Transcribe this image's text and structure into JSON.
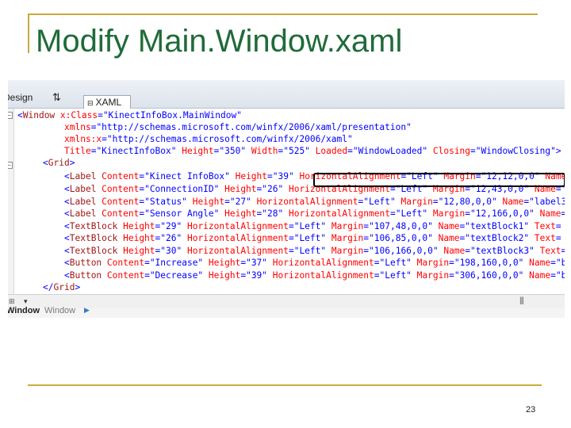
{
  "slide": {
    "title": "Modify Main.Window.xaml",
    "page_number": "23"
  },
  "designer": {
    "tabs": {
      "design": "Design",
      "swap_glyph": "⇅",
      "xaml": "XAML",
      "xaml_glyph": "⊟"
    },
    "breadcrumb": {
      "first": "Window",
      "second": "Window",
      "arrow": "▶"
    },
    "scrollbar": {
      "zoom_glyph": "⊞",
      "dropdown_glyph": "▾",
      "grip_glyph": "|||"
    }
  },
  "colors": {
    "title": "#1f6b39",
    "decor_rule": "#c8ac3a",
    "xml_element": "#a31515",
    "xml_attribute": "#ff0000",
    "xml_value": "#0000ff",
    "callout_border": "#000000"
  },
  "code": {
    "l1_lt": "<",
    "l1_tag": "Window",
    "l1_a1": " x:Class",
    "l1_e": "=",
    "l1_v1": "\"KinectInfoBox.MainWindow\"",
    "l2_a1": "xmlns",
    "l2_e": "=",
    "l2_v1": "\"http://schemas.microsoft.com/winfx/2006/xaml/presentation\"",
    "l3_a1": "xmlns:x",
    "l3_e": "=",
    "l3_v1": "\"http://schemas.microsoft.com/winfx/2006/xaml\"",
    "l4_a1": "Title",
    "l4_e1": "=",
    "l4_v1": "\"KinectInfoBox\"",
    "l4_a2": " Height",
    "l4_e2": "=",
    "l4_v2": "\"350\"",
    "l4_a3": " Width",
    "l4_e3": "=",
    "l4_v3": "\"525\"",
    "l4_a4": " Loaded",
    "l4_e4": "=",
    "l4_v4": "\"WindowLoaded\"",
    "l4_a5": " Closing",
    "l4_e5": "=",
    "l4_v5": "\"WindowClosing\"",
    "l4_gt": ">",
    "l5_lt": "<",
    "l5_tag": "Grid",
    "l5_gt": ">",
    "l6_lt": "<",
    "l6_tag": "Label",
    "l6_a1": " Content",
    "l6_e1": "=",
    "l6_v1": "\"Kinect InfoBox\"",
    "l6_a2": " Height",
    "l6_e2": "=",
    "l6_v2": "\"39\"",
    "l6_a3": " HorizontalAlignment",
    "l6_e3": "=",
    "l6_v3": "\"Left\"",
    "l6_a4": " Margin",
    "l6_e4": "=",
    "l6_v4": "\"12,12,0,0\"",
    "l6_a5": " Name",
    "l6_e5": "=",
    "l7_lt": "<",
    "l7_tag": "Label",
    "l7_a1": " Content",
    "l7_e1": "=",
    "l7_v1": "\"ConnectionID\"",
    "l7_a2": " Height",
    "l7_e2": "=",
    "l7_v2": "\"26\"",
    "l7_a3": " HorizontalAlignment",
    "l7_e3": "=",
    "l7_v3": "\"Left\"",
    "l7_a4": " Margin",
    "l7_e4": "=",
    "l7_v4": "\"12,43,0,0\"",
    "l7_a5": " Name",
    "l7_e5": "=",
    "l7_v5": "\"l",
    "l8_lt": "<",
    "l8_tag": "Label",
    "l8_a1": " Content",
    "l8_e1": "=",
    "l8_v1": "\"Status\"",
    "l8_a2": " Height",
    "l8_e2": "=",
    "l8_v2": "\"27\"",
    "l8_a3": " HorizontalAlignment",
    "l8_e3": "=",
    "l8_v3": "\"Left\"",
    "l8_a4": " Margin",
    "l8_e4": "=",
    "l8_v4": "\"12,80,0,0\"",
    "l8_a5": " Name",
    "l8_e5": "=",
    "l8_v5": "\"label3\"",
    "l9_lt": "<",
    "l9_tag": "Label",
    "l9_a1": " Content",
    "l9_e1": "=",
    "l9_v1": "\"Sensor Angle\"",
    "l9_a2": " Height",
    "l9_e2": "=",
    "l9_v2": "\"28\"",
    "l9_a3": " HorizontalAlignment",
    "l9_e3": "=",
    "l9_v3": "\"Left\"",
    "l9_a4": " Margin",
    "l9_e4": "=",
    "l9_v4": "\"12,166,0,0\"",
    "l9_a5": " Name",
    "l9_e5": "=",
    "l10_lt": "<",
    "l10_tag": "TextBlock",
    "l10_a1": " Height",
    "l10_e1": "=",
    "l10_v1": "\"29\"",
    "l10_a2": " HorizontalAlignment",
    "l10_e2": "=",
    "l10_v2": "\"Left\"",
    "l10_a3": " Margin",
    "l10_e3": "=",
    "l10_v3": "\"107,48,0,0\"",
    "l10_a4": " Name",
    "l10_e4": "=",
    "l10_v4": "\"textBlock1\"",
    "l10_a5": " Text",
    "l10_e5": "=",
    "l11_lt": "<",
    "l11_tag": "TextBlock",
    "l11_a1": " Height",
    "l11_e1": "=",
    "l11_v1": "\"26\"",
    "l11_a2": " HorizontalAlignment",
    "l11_e2": "=",
    "l11_v2": "\"Left\"",
    "l11_a3": " Margin",
    "l11_e3": "=",
    "l11_v3": "\"106,85,0,0\"",
    "l11_a4": " Name",
    "l11_e4": "=",
    "l11_v4": "\"textBlock2\"",
    "l11_a5": " Text",
    "l11_e5": "=",
    "l12_lt": "<",
    "l12_tag": "TextBlock",
    "l12_a1": " Height",
    "l12_e1": "=",
    "l12_v1": "\"30\"",
    "l12_a2": " HorizontalAlignment",
    "l12_e2": "=",
    "l12_v2": "\"Left\"",
    "l12_a3": " Margin",
    "l12_e3": "=",
    "l12_v3": "\"106,166,0,0\"",
    "l12_a4": " Name",
    "l12_e4": "=",
    "l12_v4": "\"textBlock3\"",
    "l12_a5": " Text",
    "l12_e5": "=",
    "l13_lt": "<",
    "l13_tag": "Button",
    "l13_a1": " Content",
    "l13_e1": "=",
    "l13_v1": "\"Increase\"",
    "l13_a2": " Height",
    "l13_e2": "=",
    "l13_v2": "\"37\"",
    "l13_a3": " HorizontalAlignment",
    "l13_e3": "=",
    "l13_v3": "\"Left\"",
    "l13_a4": " Margin",
    "l13_e4": "=",
    "l13_v4": "\"198,160,0,0\"",
    "l13_a5": " Name",
    "l13_e5": "=",
    "l13_v5": "\"bu",
    "l14_lt": "<",
    "l14_tag": "Button",
    "l14_a1": " Content",
    "l14_e1": "=",
    "l14_v1": "\"Decrease\"",
    "l14_a2": " Height",
    "l14_e2": "=",
    "l14_v2": "\"39\"",
    "l14_a3": " HorizontalAlignment",
    "l14_e3": "=",
    "l14_v3": "\"Left\"",
    "l14_a4": " Margin",
    "l14_e4": "=",
    "l14_v4": "\"306,160,0,0\"",
    "l14_a5": " Name",
    "l14_e5": "=",
    "l14_v5": "\"bu",
    "l15_lt": "</",
    "l15_tag": "Grid",
    "l15_gt": ">"
  }
}
